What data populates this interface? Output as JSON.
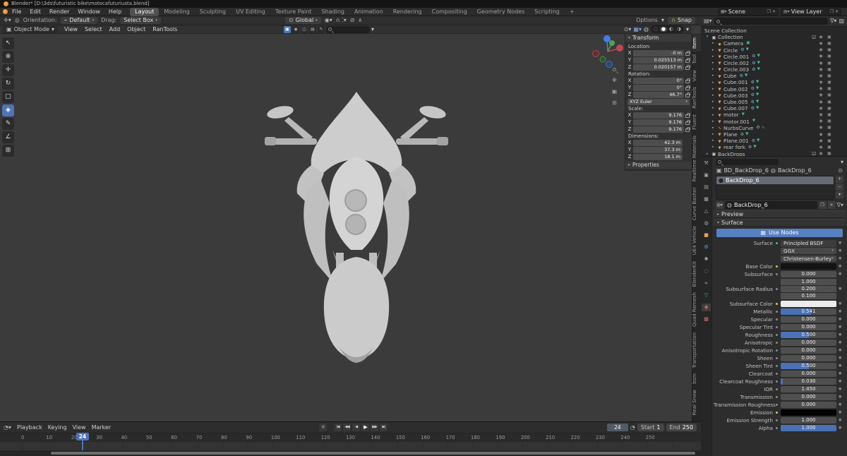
{
  "titlebar": {
    "title": "Blender* [D:\\3ds\\futuristic bike\\motocafuturiusta.blend]"
  },
  "menubar": {
    "menus": [
      "File",
      "Edit",
      "Render",
      "Window",
      "Help"
    ],
    "workspaces": [
      "Layout",
      "Modeling",
      "Sculpting",
      "UV Editing",
      "Texture Paint",
      "Shading",
      "Animation",
      "Rendering",
      "Compositing",
      "Geometry Nodes",
      "Scripting",
      "+"
    ],
    "scene_label": "Scene",
    "view_layer_label": "View Layer"
  },
  "tool_settings": {
    "orientation_label": "Orientation:",
    "orientation_value": "Default",
    "drag_label": "Drag:",
    "drag_value": "Select Box",
    "transform_space": "Global",
    "options_label": "Options",
    "snap_label": "Snap"
  },
  "viewport_header": {
    "mode": "Object Mode",
    "menus": [
      "View",
      "Select",
      "Add",
      "Object",
      "RanTools"
    ]
  },
  "viewport": {
    "toolbar_icons": [
      "select-box",
      "cursor",
      "move",
      "rotate",
      "scale",
      "transform",
      "annotate",
      "measure",
      "add-cube"
    ],
    "active_tool": "transform",
    "nav_icons": [
      "zoom",
      "pan",
      "camera-view",
      "toggle-projection"
    ]
  },
  "npanel": {
    "tabs": [
      "Item",
      "Tool",
      "View",
      "RanTools",
      "Fluent",
      "Realtime Materials",
      "Curve Basher",
      "UE4 Vehicle",
      "BlenderKit",
      "Quad Remesh",
      "Transportation",
      "bsm",
      "Real Snow"
    ],
    "active_tab": "Item",
    "transform_title": "Transform",
    "location_label": "Location:",
    "loc_x": "-0 m",
    "loc_y": "0.025513 m",
    "loc_z": "0.020157 m",
    "rotation_label": "Rotation:",
    "rot_x": "0°",
    "rot_y": "0°",
    "rot_z": "46.7°",
    "rotation_mode": "XYZ Euler",
    "scale_label": "Scale:",
    "scale_x": "9.176",
    "scale_y": "9.176",
    "scale_z": "9.176",
    "dimensions_label": "Dimensions:",
    "dim_x": "42.3 m",
    "dim_y": "37.3 m",
    "dim_z": "18.1 m",
    "axis_x": "X",
    "axis_y": "Y",
    "axis_z": "Z",
    "properties_label": "Properties"
  },
  "outliner": {
    "scene_root": "Scene Collection",
    "collection": "Collection",
    "backdrops": "BackDrops",
    "items": [
      {
        "name": "Camera",
        "type": "cam",
        "badges": "camdata"
      },
      {
        "name": "Circle",
        "type": "mesh",
        "badges": "mod data"
      },
      {
        "name": "Circle.001",
        "type": "mesh",
        "badges": "mod data"
      },
      {
        "name": "Circle.002",
        "type": "mesh",
        "badges": "mod data"
      },
      {
        "name": "Circle.003",
        "type": "mesh",
        "badges": "mod data"
      },
      {
        "name": "Cube",
        "type": "mesh",
        "badges": "mod data"
      },
      {
        "name": "Cube.001",
        "type": "mesh",
        "badges": "mod data"
      },
      {
        "name": "Cube.002",
        "type": "mesh",
        "badges": "mod data"
      },
      {
        "name": "Cube.003",
        "type": "mesh",
        "badges": "mod data"
      },
      {
        "name": "Cube.005",
        "type": "mesh",
        "badges": "mod data"
      },
      {
        "name": "Cube.007",
        "type": "mesh",
        "badges": "mod data"
      },
      {
        "name": "motor",
        "type": "mesh",
        "badges": "data"
      },
      {
        "name": "motor.001",
        "type": "mesh",
        "badges": "data"
      },
      {
        "name": "NurbsCurve",
        "type": "curve",
        "badges": "mod curvedata"
      },
      {
        "name": "Plane",
        "type": "mesh",
        "badges": "mod data"
      },
      {
        "name": "Plane.001",
        "type": "mesh",
        "badges": "mod data"
      },
      {
        "name": "rear fork",
        "type": "mesh",
        "badges": "mod data"
      }
    ]
  },
  "properties": {
    "tab_icons": [
      "active-tool",
      "render",
      "output",
      "view-layer",
      "scene",
      "world",
      "object",
      "modifiers",
      "particles",
      "physics",
      "constraints",
      "object-data",
      "material",
      "texture"
    ],
    "active_tab": "material",
    "breadcrumb_object": "BD_BackDrop_6",
    "breadcrumb_material": "BackDrop_6",
    "slot_name": "BackDrop_6",
    "material_name": "BackDrop_6",
    "preview_label": "Preview",
    "surface_panel_label": "Surface",
    "use_nodes_label": "Use Nodes",
    "surface_label": "Surface",
    "surface_value": "Principled BSDF",
    "distribution": "GGX",
    "subsurface_method": "Christensen-Burley",
    "base_color_label": "Base Color",
    "subsurface_radius_label": "Subsurface Radius",
    "radius_values": [
      "1.000",
      "0.200",
      "0.100"
    ],
    "subsurface_color_label": "Subsurface Color",
    "emission_label": "Emission",
    "sliders_a": [
      {
        "label": "Subsurface",
        "value": "0.000",
        "fill": 0
      }
    ],
    "sliders_b": [
      {
        "label": "Metallic",
        "value": "0.541",
        "fill": 0.54
      },
      {
        "label": "Specular",
        "value": "0.000",
        "fill": 0
      },
      {
        "label": "Specular Tint",
        "value": "0.000",
        "fill": 0
      },
      {
        "label": "Roughness",
        "value": "0.500",
        "fill": 0.5
      },
      {
        "label": "Anisotropic",
        "value": "0.000",
        "fill": 0
      },
      {
        "label": "Anisotropic Rotation",
        "value": "0.000",
        "fill": 0
      },
      {
        "label": "Sheen",
        "value": "0.000",
        "fill": 0
      },
      {
        "label": "Sheen Tint",
        "value": "0.500",
        "fill": 0.5
      },
      {
        "label": "Clearcoat",
        "value": "0.000",
        "fill": 0
      },
      {
        "label": "Clearcoat Roughness",
        "value": "0.030",
        "fill": 0.04
      },
      {
        "label": "IOR",
        "value": "1.450",
        "fill": 0
      },
      {
        "label": "Transmission",
        "value": "0.000",
        "fill": 0
      },
      {
        "label": "Transmission Roughness",
        "value": "0.000",
        "fill": 0
      }
    ],
    "sliders_c": [
      {
        "label": "Emission Strength",
        "value": "1.000",
        "fill": 0
      },
      {
        "label": "Alpha",
        "value": "1.000",
        "fill": 1
      }
    ]
  },
  "timeline": {
    "menus": [
      "Playback",
      "Keying",
      "View",
      "Marker"
    ],
    "current_frame": "24",
    "start_label": "Start",
    "start_value": "1",
    "end_label": "End",
    "end_value": "250",
    "ticks": [
      "0",
      "10",
      "20",
      "30",
      "40",
      "50",
      "60",
      "70",
      "80",
      "90",
      "100",
      "110",
      "120",
      "130",
      "140",
      "150",
      "160",
      "170",
      "180",
      "190",
      "200",
      "210",
      "220",
      "230",
      "240",
      "250"
    ]
  },
  "colors": {
    "accent": "#4f74b8",
    "use_nodes_blue": "#5680c2",
    "snap_green": "#8fbf62",
    "object_orange": "#ef9f4e",
    "data_green": "#35c79b"
  }
}
